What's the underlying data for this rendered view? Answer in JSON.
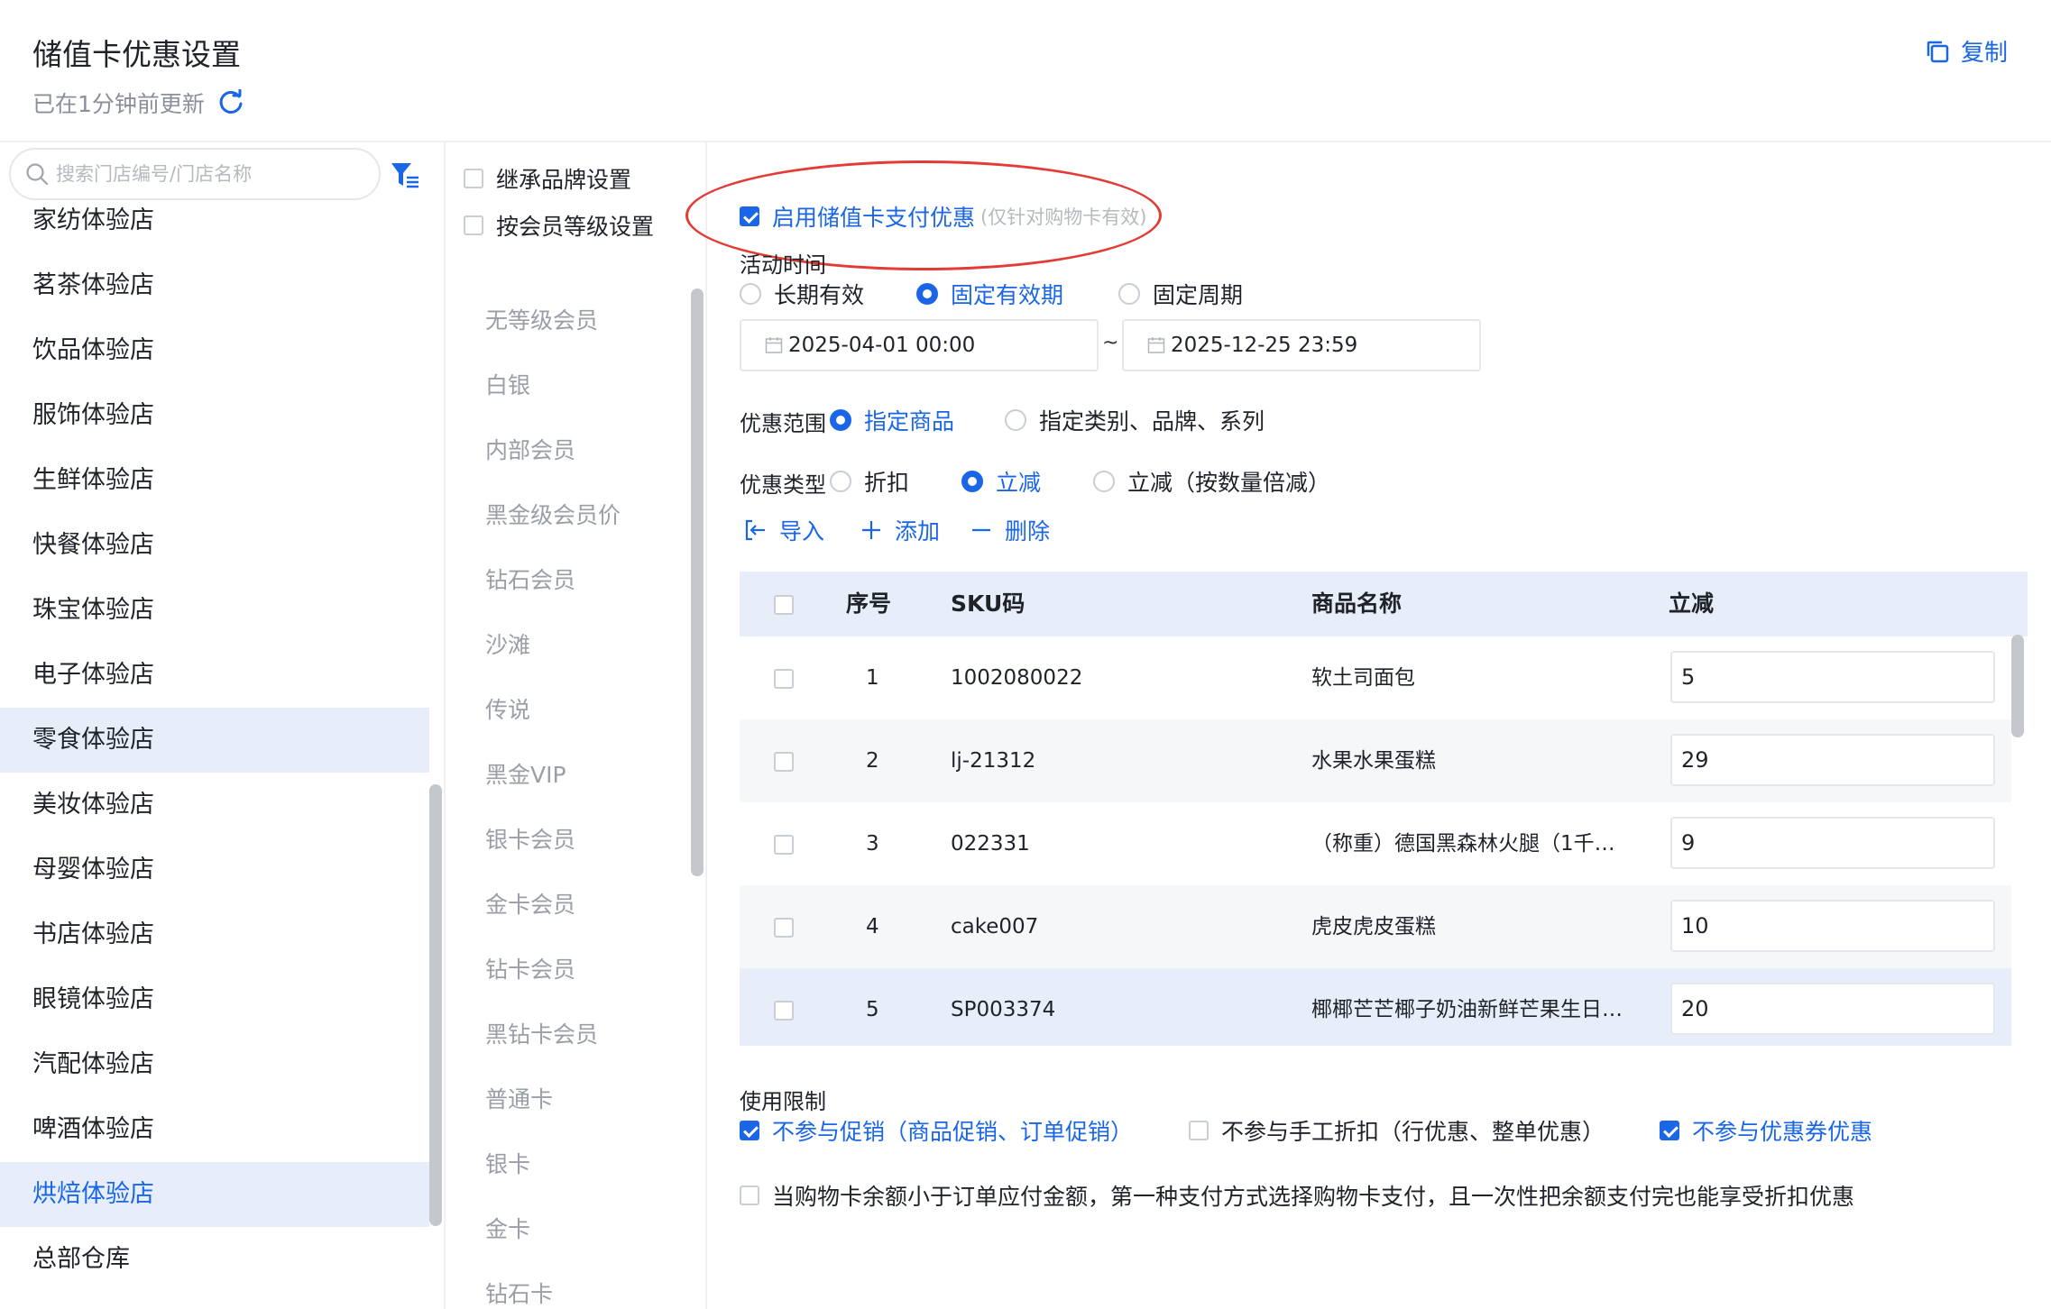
{
  "header": {
    "title": "储值卡优惠设置",
    "updated": "已在1分钟前更新",
    "copy_label": "复制"
  },
  "stores": {
    "search_placeholder": "搜索门店编号/门店名称",
    "items": [
      "家纺体验店",
      "茗茶体验店",
      "饮品体验店",
      "服饰体验店",
      "生鲜体验店",
      "快餐体验店",
      "珠宝体验店",
      "电子体验店",
      "零食体验店",
      "美妆体验店",
      "母婴体验店",
      "书店体验店",
      "眼镜体验店",
      "汽配体验店",
      "啤酒体验店",
      "烘焙体验店",
      "总部仓库"
    ],
    "active": "烘焙体验店",
    "hover": "零食体验店"
  },
  "levels": {
    "inherit_label": "继承品牌设置",
    "by_level_label": "按会员等级设置",
    "items": [
      "无等级会员",
      "白银",
      "内部会员",
      "黑金级会员价",
      "钻石会员",
      "沙滩",
      "传说",
      "黑金VIP",
      "银卡会员",
      "金卡会员",
      "钻卡会员",
      "黑钻卡会员",
      "普通卡",
      "银卡",
      "金卡",
      "钻石卡"
    ]
  },
  "main": {
    "enable_label": "启用储值卡支付优惠",
    "enable_hint": "(仅针对购物卡有效)",
    "time_label": "活动时间",
    "time_options": [
      "长期有效",
      "固定有效期",
      "固定周期"
    ],
    "time_selected": "固定有效期",
    "start_date": "2025-04-01 00:00",
    "end_date": "2025-12-25 23:59",
    "tilde": "~",
    "scope_label": "优惠范围",
    "scope_options": [
      "指定商品",
      "指定类别、品牌、系列"
    ],
    "type_label": "优惠类型",
    "type_options": [
      "折扣",
      "立减",
      "立减（按数量倍减）"
    ],
    "actions": {
      "import": "导入",
      "add": "添加",
      "delete": "删除"
    },
    "table": {
      "headers": [
        "序号",
        "SKU码",
        "商品名称",
        "立减"
      ],
      "rows": [
        {
          "idx": "1",
          "sku": "1002080022",
          "name": "软土司面包",
          "value": "5"
        },
        {
          "idx": "2",
          "sku": "lj-21312",
          "name": "水果水果蛋糕",
          "value": "29"
        },
        {
          "idx": "3",
          "sku": "022331",
          "name": "（称重）德国黑森林火腿（1千…",
          "value": "9"
        },
        {
          "idx": "4",
          "sku": "cake007",
          "name": "虎皮虎皮蛋糕",
          "value": "10"
        },
        {
          "idx": "5",
          "sku": "SP003374",
          "name": "椰椰芒芒椰子奶油新鲜芒果生日…",
          "value": "20"
        }
      ]
    },
    "limit_label": "使用限制",
    "limits": [
      "不参与促销（商品促销、订单促销）",
      "不参与手工折扣（行优惠、整单优惠）",
      "不参与优惠券优惠"
    ],
    "balance_rule": "当购物卡余额小于订单应付金额，第一种支付方式选择购物卡支付，且一次性把余额支付完也能享受折扣优惠"
  },
  "colors": {
    "accent": "#1a66e6",
    "highlight": "#e33b36"
  }
}
